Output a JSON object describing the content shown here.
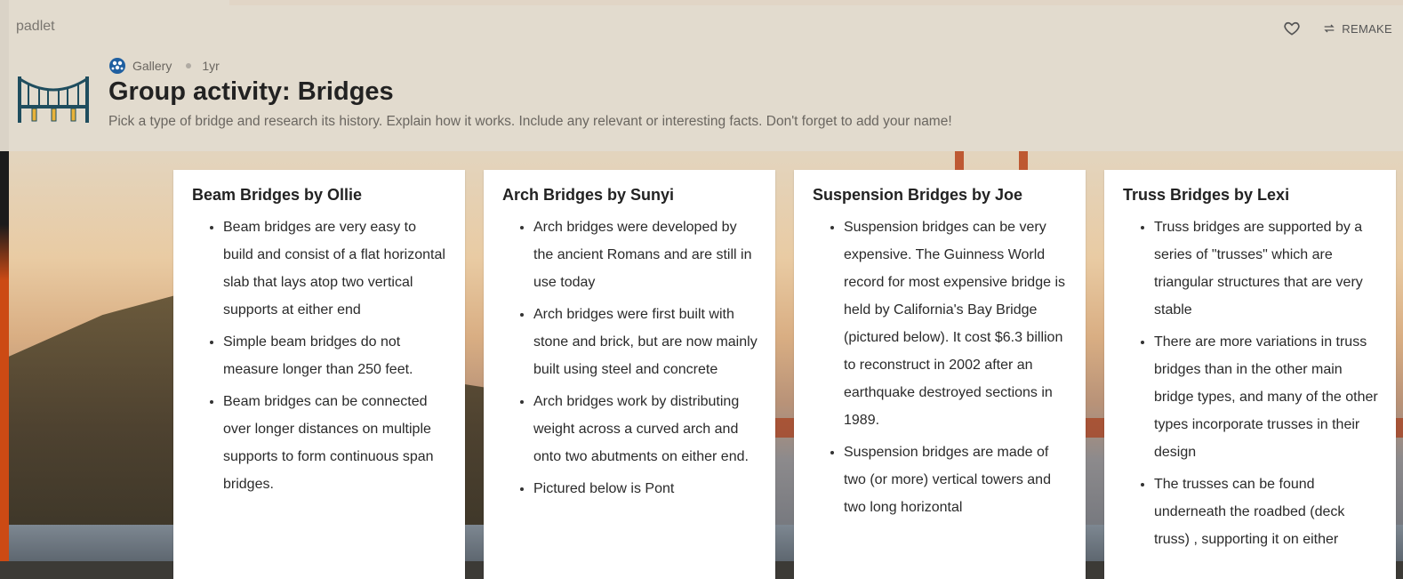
{
  "app": {
    "brand": "padlet"
  },
  "header": {
    "remake_label": "REMAKE",
    "meta": {
      "author": "Gallery",
      "age": "1yr"
    },
    "title": "Group activity: Bridges",
    "subtitle": "Pick a type of bridge and research its history. Explain how it works. Include any relevant or interesting facts. Don't forget to add your name!"
  },
  "posts": [
    {
      "title": "Beam Bridges by Ollie",
      "bullets": [
        "Beam bridges are very easy to build and consist of a flat horizontal slab that lays atop two vertical supports at either end",
        "Simple beam bridges do not measure longer than 250 feet.",
        "Beam bridges can be connected over longer distances on multiple supports to form continuous span bridges."
      ]
    },
    {
      "title": "Arch Bridges by Sunyi",
      "bullets": [
        "Arch bridges were developed by the ancient Romans and are still in use today",
        "Arch bridges were first built with stone and brick, but are now mainly built using steel and concrete",
        "Arch bridges work by distributing weight across a curved arch and onto two abutments on either end.",
        "Pictured below is Pont"
      ]
    },
    {
      "title": "Suspension Bridges by Joe",
      "bullets": [
        "Suspension bridges can be very expensive. The Guinness World record for most expensive bridge is held by California's Bay Bridge (pictured below). It cost $6.3 billion to reconstruct  in 2002 after an earthquake destroyed sections in 1989.",
        "Suspension bridges are made of two (or more) vertical towers and two long horizontal"
      ]
    },
    {
      "title": "Truss Bridges by Lexi",
      "bullets": [
        "Truss bridges are supported by a series of \"trusses\" which are triangular structures that are very stable",
        "There are more variations in truss bridges than in the other main bridge types, and many of the other types incorporate trusses in their design",
        "The trusses can be found underneath the roadbed (deck truss) , supporting it on either"
      ]
    }
  ],
  "colors": {
    "header_bg": "#e2dbce",
    "card_bg": "#ffffff",
    "accent_orange": "#cf4a12"
  }
}
